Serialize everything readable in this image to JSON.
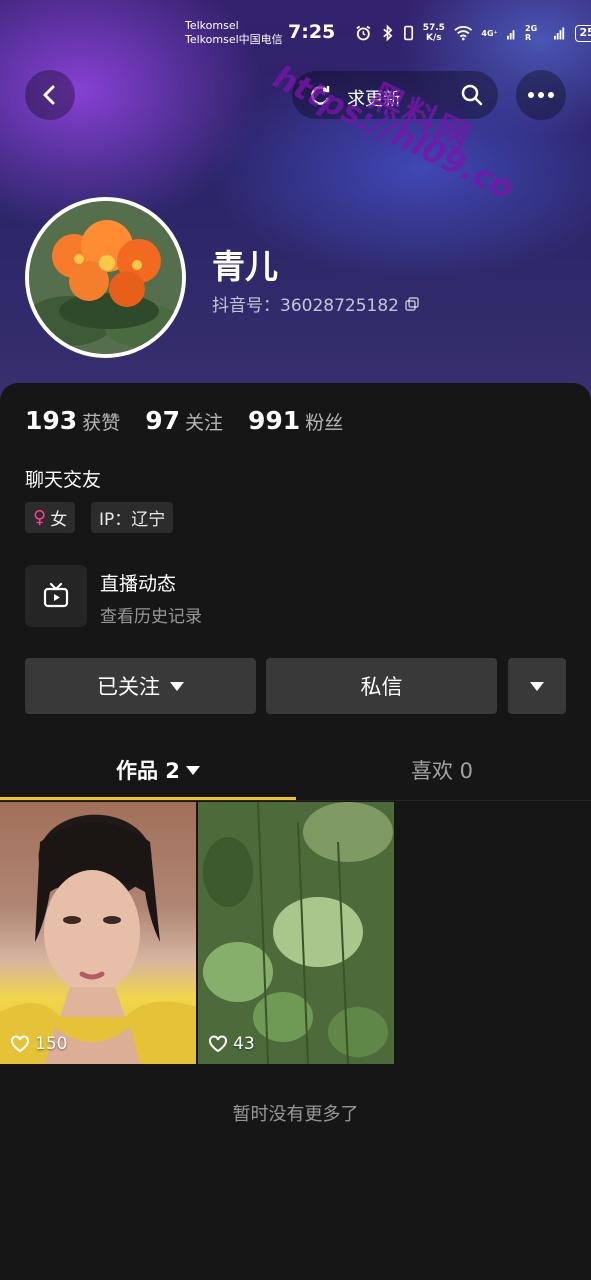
{
  "status_bar": {
    "carrier_1": "Telkomsel",
    "carrier_2": "Telkomsel中国电信",
    "time": "7:25",
    "speed_top": "57.5",
    "speed_bottom": "K/s",
    "net_1": "4G⁺",
    "net_2": "2G R",
    "battery": "25"
  },
  "nav": {
    "search_label": "求更新",
    "back_icon": "chevron-left-icon",
    "search_icon": "search-icon",
    "more_icon": "more-dots-icon"
  },
  "watermark": {
    "text_cn": "黑料网",
    "text_url": "https://hl09.co"
  },
  "profile": {
    "nickname": "青儿",
    "douyin_id": "抖音号：36028725182",
    "stats": [
      {
        "num": "193",
        "label": "获赞"
      },
      {
        "num": "97",
        "label": "关注"
      },
      {
        "num": "991",
        "label": "粉丝"
      }
    ],
    "bio": "聊天交友",
    "gender_tag": "女",
    "ip_tag": "IP：辽宁"
  },
  "live": {
    "title": "直播动态",
    "subtitle": "查看历史记录"
  },
  "actions": {
    "follow_label": "已关注",
    "message_label": "私信"
  },
  "tabs": {
    "works": "作品 2",
    "likes": "喜欢 0"
  },
  "videos": [
    {
      "likes": "150"
    },
    {
      "likes": "43"
    }
  ],
  "footer": {
    "no_more": "暂时没有更多了"
  },
  "colors": {
    "accent_underline": "#f2c617",
    "female": "#ff3e91",
    "background": "#161616"
  }
}
